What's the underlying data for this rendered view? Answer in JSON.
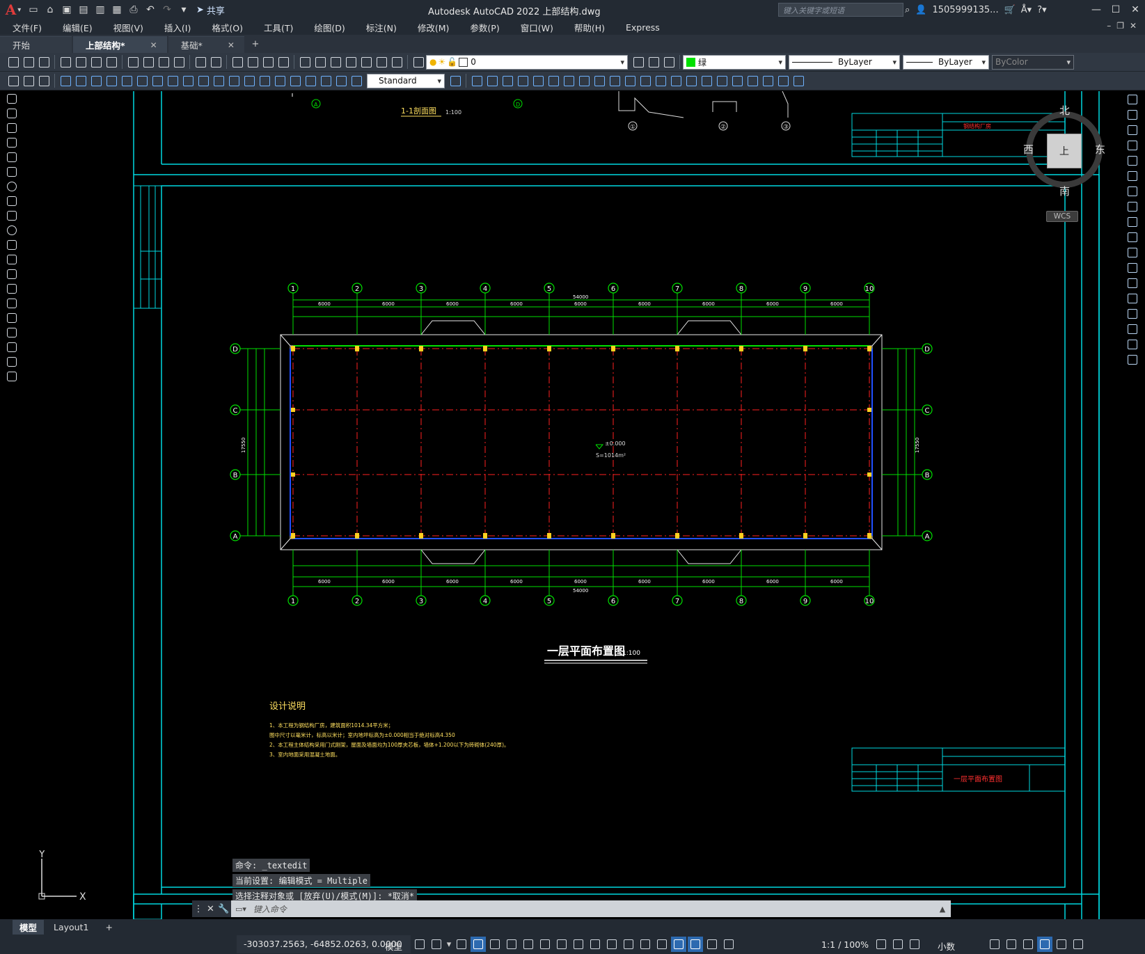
{
  "app": {
    "title": "Autodesk AutoCAD 2022    上部结构.dwg",
    "search_placeholder": "键入关键字或短语",
    "user": "1505999135...",
    "share_label": "共享",
    "logo": "A"
  },
  "menu": [
    "文件(F)",
    "编辑(E)",
    "视图(V)",
    "插入(I)",
    "格式(O)",
    "工具(T)",
    "绘图(D)",
    "标注(N)",
    "修改(M)",
    "参数(P)",
    "窗口(W)",
    "帮助(H)",
    "Express"
  ],
  "tabs": [
    {
      "label": "开始",
      "active": false
    },
    {
      "label": "上部结构*",
      "active": true
    },
    {
      "label": "基础*",
      "active": false
    }
  ],
  "toolbar": {
    "layer_value": "0",
    "color_value": "绿",
    "color_hex": "#00e000",
    "linetype_value": "ByLayer",
    "lineweight_value": "ByLayer",
    "plotstyle_value": "ByColor",
    "textstyle_value": "Standard"
  },
  "viewcube": {
    "n": "北",
    "s": "南",
    "e": "东",
    "w": "西",
    "face": "上",
    "wcs": "WCS"
  },
  "drawing": {
    "section_title": "1-1剖面图",
    "section_scale": "1:100",
    "plan_title": "一层平面布置图",
    "plan_scale": "1:100",
    "area_label": "S=1014m²",
    "elev_label": "±0.000",
    "axes_x": [
      "1",
      "2",
      "3",
      "4",
      "5",
      "6",
      "7",
      "8",
      "9",
      "10"
    ],
    "axes_y": [
      "D",
      "C",
      "B",
      "A"
    ],
    "total_dim": "54000",
    "bay_dims": [
      "6000",
      "6000",
      "6000",
      "6000",
      "6000",
      "6000",
      "6000",
      "6000",
      "6000"
    ],
    "side_dim": "17550",
    "detail_labels": [
      "①",
      "②",
      "③"
    ],
    "notes_title": "设计说明",
    "notes": [
      "1、本工程为钢结构厂房，建筑面积1014.34平方米；",
      "   图中尺寸以毫米计，标高以米计；室内地坪标高为±0.000相当于绝对标高4.350",
      "2、本工程主体结构采用门式刚架，屋面及墙面均为100厚夹芯板，墙体+1.200以下为砖砌体(240厚)。",
      "3、室内地面采用混凝土地面。"
    ],
    "titleblock_name": "一层平面布置图",
    "titleblock_top_name": "钢结构厂房"
  },
  "command": {
    "history": [
      "命令: _textedit",
      "当前设置: 编辑模式 = Multiple",
      "选择注释对象或 [放弃(U)/模式(M)]: *取消*"
    ],
    "placeholder": "键入命令"
  },
  "layouts": [
    {
      "label": "模型",
      "active": true
    },
    {
      "label": "Layout1",
      "active": false
    }
  ],
  "status": {
    "coords": "-303037.2563, -64852.0263, 0.0000",
    "model": "模型",
    "scale": "1:1 / 100%",
    "units": "小数"
  }
}
